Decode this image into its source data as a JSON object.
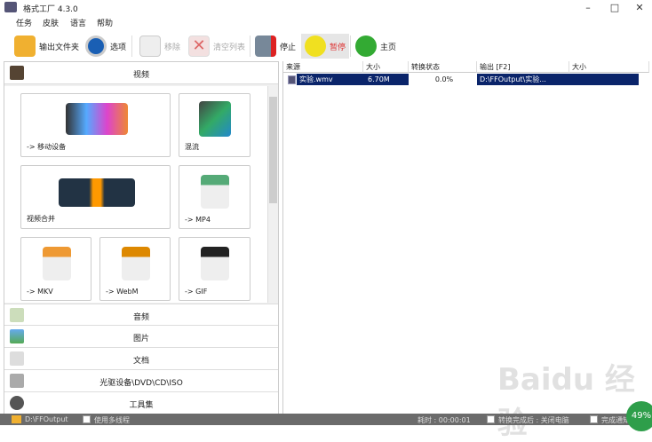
{
  "title": "格式工厂 4.3.0",
  "menu": [
    "任务",
    "皮肤",
    "语言",
    "帮助"
  ],
  "toolbar": {
    "output_folder": "输出文件夹",
    "options": "选项",
    "remove": "移除",
    "clear_list": "清空列表",
    "stop": "停止",
    "pause": "暂停",
    "home": "主页"
  },
  "left": {
    "video_header": "视频",
    "tiles": [
      "-> 移动设备",
      "混流",
      "视频合并",
      "-> MP4",
      "-> MKV",
      "-> WebM",
      "-> GIF"
    ],
    "categories": [
      "音频",
      "图片",
      "文档",
      "光驱设备\\DVD\\CD\\ISO",
      "工具集"
    ]
  },
  "table": {
    "headers": [
      "来源",
      "大小",
      "转换状态",
      "输出 [F2]",
      "大小"
    ],
    "rows": [
      {
        "source": "实验.wmv",
        "size": "6.70M",
        "status": "0.0%",
        "output": "D:\\FFOutput\\实验...",
        "out_size": ""
      }
    ]
  },
  "status": {
    "folder": "D:\\FFOutput",
    "multithread": "使用多线程",
    "elapsed": "耗时 : 00:00:01",
    "after": "转换完成后 : 关闭电脑",
    "notify": "完成通知"
  },
  "badge": "49%",
  "watermark": "Baidu 经验"
}
